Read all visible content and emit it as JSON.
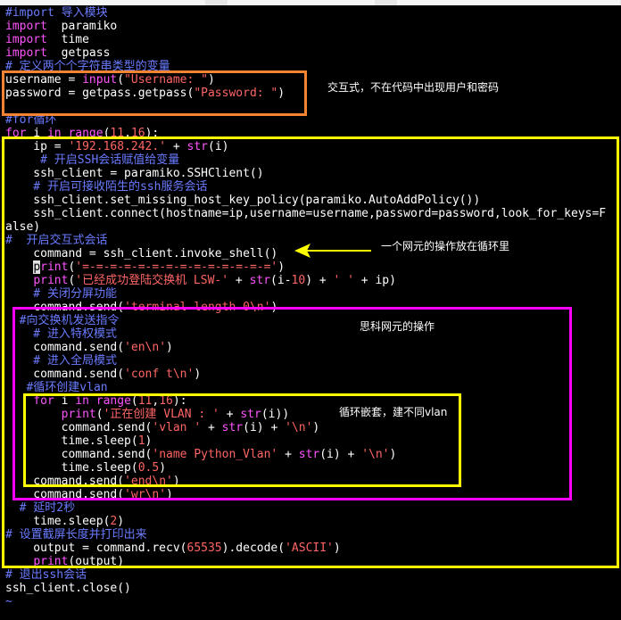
{
  "code_lines": [
    [
      [
        "cmt",
        "#import 导入模块"
      ]
    ],
    [
      [
        "kw",
        "import"
      ],
      [
        "",
        "  paramiko"
      ]
    ],
    [
      [
        "kw",
        "import"
      ],
      [
        "",
        "  time"
      ]
    ],
    [
      [
        "kw",
        "import"
      ],
      [
        "",
        "  getpass"
      ]
    ],
    [
      [
        "cmt",
        "# 定义两个个字符串类型的变量"
      ]
    ],
    [
      [
        "",
        "username = "
      ],
      [
        "kw",
        "input"
      ],
      [
        "",
        "("
      ],
      [
        "str",
        "\"Username: \""
      ],
      [
        "",
        ")"
      ]
    ],
    [
      [
        "",
        "password = getpass.getpass("
      ],
      [
        "str",
        "\"Password: \""
      ],
      [
        "",
        ")"
      ]
    ],
    [
      [
        "",
        ""
      ]
    ],
    [
      [
        "cmt",
        "#for循环"
      ]
    ],
    [
      [
        "kw",
        "for"
      ],
      [
        "",
        " i "
      ],
      [
        "kw",
        "in"
      ],
      [
        "",
        " "
      ],
      [
        "kw",
        "range"
      ],
      [
        "",
        "("
      ],
      [
        "num",
        "11"
      ],
      [
        "",
        ","
      ],
      [
        "num",
        "16"
      ],
      [
        "",
        "):"
      ]
    ],
    [
      [
        "",
        "    ip = "
      ],
      [
        "str",
        "'192.168.242.'"
      ],
      [
        "",
        " + "
      ],
      [
        "kw",
        "str"
      ],
      [
        "",
        "(i)"
      ]
    ],
    [
      [
        "cmt",
        "     # 开启SSH会话赋值给变量"
      ]
    ],
    [
      [
        "",
        "    ssh_client = paramiko.SSHClient()"
      ]
    ],
    [
      [
        "cmt",
        "    # 开启可接收陌生的ssh服务会话"
      ]
    ],
    [
      [
        "",
        "    ssh_client.set_missing_host_key_policy(paramiko.AutoAddPolicy())"
      ]
    ],
    [
      [
        "",
        "    ssh_client.connect(hostname=ip,username=username,password=password,look_for_keys=F"
      ]
    ],
    [
      [
        "",
        "alse)"
      ]
    ],
    [
      [
        "cmt",
        "#  开启交互式会话"
      ]
    ],
    [
      [
        "",
        "    command = ssh_client.invoke_shell()"
      ]
    ],
    [
      [
        "",
        "    "
      ],
      [
        "cursor",
        "p"
      ],
      [
        "kw",
        "rint"
      ],
      [
        "",
        "("
      ],
      [
        "str",
        "'=-=-=-=-=-=-=-=-=-=-=-=-=-='"
      ],
      [
        "",
        ")"
      ]
    ],
    [
      [
        "",
        "    "
      ],
      [
        "kw",
        "print"
      ],
      [
        "",
        "("
      ],
      [
        "str",
        "'已经成功登陆交换机 LSW-'"
      ],
      [
        "",
        " + "
      ],
      [
        "kw",
        "str"
      ],
      [
        "",
        "(i-"
      ],
      [
        "num",
        "10"
      ],
      [
        "",
        ") + "
      ],
      [
        "str",
        "' '"
      ],
      [
        "",
        " + ip)"
      ]
    ],
    [
      [
        "cmt",
        "    # 关闭分屏功能"
      ]
    ],
    [
      [
        "",
        "    command.send("
      ],
      [
        "str",
        "'terminal length 0\\n'"
      ],
      [
        "",
        ")"
      ]
    ],
    [
      [
        "cmt",
        "  #向交换机发送指令"
      ]
    ],
    [
      [
        "cmt",
        "    # 进入特权模式"
      ]
    ],
    [
      [
        "",
        "    command.send("
      ],
      [
        "str",
        "'en\\n'"
      ],
      [
        "",
        ")"
      ]
    ],
    [
      [
        "cmt",
        "    # 进入全局模式"
      ]
    ],
    [
      [
        "",
        "    command.send("
      ],
      [
        "str",
        "'conf t\\n'"
      ],
      [
        "",
        ")"
      ]
    ],
    [
      [
        "cmt",
        "   #循环创建vlan"
      ]
    ],
    [
      [
        "",
        "    "
      ],
      [
        "kw",
        "for"
      ],
      [
        "",
        " i "
      ],
      [
        "kw",
        "in"
      ],
      [
        "",
        " "
      ],
      [
        "kw",
        "range"
      ],
      [
        "",
        "("
      ],
      [
        "num",
        "11"
      ],
      [
        "",
        ","
      ],
      [
        "num",
        "16"
      ],
      [
        "",
        "):"
      ]
    ],
    [
      [
        "",
        "        "
      ],
      [
        "kw",
        "print"
      ],
      [
        "",
        "("
      ],
      [
        "str",
        "'正在创建 VLAN : '"
      ],
      [
        "",
        " + "
      ],
      [
        "kw",
        "str"
      ],
      [
        "",
        "(i))"
      ]
    ],
    [
      [
        "",
        "        command.send("
      ],
      [
        "str",
        "'vlan '"
      ],
      [
        "",
        " + "
      ],
      [
        "kw",
        "str"
      ],
      [
        "",
        "(i) + "
      ],
      [
        "str",
        "'\\n'"
      ],
      [
        "",
        ")"
      ]
    ],
    [
      [
        "",
        "        time.sleep("
      ],
      [
        "num",
        "1"
      ],
      [
        "",
        ")"
      ]
    ],
    [
      [
        "",
        "        command.send("
      ],
      [
        "str",
        "'name Python_Vlan'"
      ],
      [
        "",
        " + "
      ],
      [
        "kw",
        "str"
      ],
      [
        "",
        "(i) + "
      ],
      [
        "str",
        "'\\n'"
      ],
      [
        "",
        ")"
      ]
    ],
    [
      [
        "",
        "        time.sleep("
      ],
      [
        "num",
        "0.5"
      ],
      [
        "",
        ")"
      ]
    ],
    [
      [
        "",
        "    command.send("
      ],
      [
        "str",
        "'end\\n'"
      ],
      [
        "",
        ")"
      ]
    ],
    [
      [
        "",
        "    command.send("
      ],
      [
        "str",
        "'wr\\n'"
      ],
      [
        "",
        ")"
      ]
    ],
    [
      [
        "cmt",
        "  # 延时2秒"
      ]
    ],
    [
      [
        "",
        "    time.sleep("
      ],
      [
        "num",
        "2"
      ],
      [
        "",
        ")"
      ]
    ],
    [
      [
        "cmt",
        "# 设置截屏长度并打印出来"
      ]
    ],
    [
      [
        "",
        "    output = command.recv("
      ],
      [
        "num",
        "65535"
      ],
      [
        "",
        ").decode("
      ],
      [
        "str",
        "'ASCII'"
      ],
      [
        "",
        ")"
      ]
    ],
    [
      [
        "",
        "    "
      ],
      [
        "kw",
        "print"
      ],
      [
        "",
        "(output)"
      ]
    ],
    [
      [
        "cmt",
        "# 退出ssh会话"
      ]
    ],
    [
      [
        "",
        "ssh_client.close()"
      ]
    ],
    [
      [
        "tilde",
        "~"
      ]
    ]
  ],
  "annotations": {
    "interactive_note": "交互式，不在代码中出现用户和密码",
    "loop_note": "一个网元的操作放在循环里",
    "cisco_note": "思科网元的操作",
    "nested_note": "循环嵌套，建不同vlan"
  },
  "colors": {
    "keyword": "#ff55ff",
    "string": "#ff6565",
    "comment": "#6a7bff",
    "text": "#ffffff",
    "background": "#000000",
    "box_orange": "#f48432",
    "box_yellow": "#ffff00",
    "box_magenta": "#ff00ff"
  }
}
